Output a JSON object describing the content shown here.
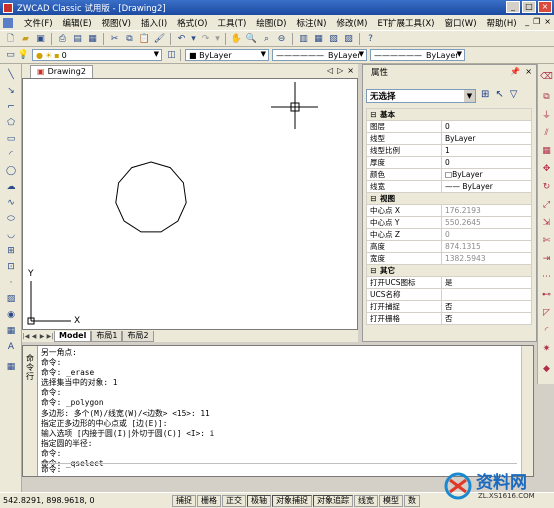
{
  "window": {
    "title": "ZWCAD Classic 试用版 - [Drawing2]"
  },
  "menu": [
    "文件(F)",
    "编辑(E)",
    "视图(V)",
    "插入(I)",
    "格式(O)",
    "工具(T)",
    "绘图(D)",
    "标注(N)",
    "修改(M)",
    "ET扩展工具(X)",
    "窗口(W)",
    "帮助(H)"
  ],
  "layerbar": {
    "layer_value": "0",
    "color_value": "■ ByLayer",
    "linetype_value": "ByLayer",
    "lineweight_value": "ByLayer"
  },
  "document": {
    "tab_label": "Drawing2"
  },
  "axes": {
    "x": "X",
    "y": "Y"
  },
  "layout_tabs": [
    "Model",
    "布局1",
    "布局2"
  ],
  "properties": {
    "title": "属性",
    "selection": "无选择",
    "categories": [
      {
        "name": "基本",
        "rows": [
          {
            "key": "图层",
            "value": "0"
          },
          {
            "key": "线型",
            "value": "ByLayer"
          },
          {
            "key": "线型比例",
            "value": "1"
          },
          {
            "key": "厚度",
            "value": "0"
          },
          {
            "key": "颜色",
            "value": "□ByLayer"
          },
          {
            "key": "线宽",
            "value": "—— ByLayer"
          }
        ]
      },
      {
        "name": "视图",
        "rows": [
          {
            "key": "中心点 X",
            "value": "176.2193",
            "muted": true
          },
          {
            "key": "中心点 Y",
            "value": "550.2645",
            "muted": true
          },
          {
            "key": "中心点 Z",
            "value": "0",
            "muted": true
          },
          {
            "key": "高度",
            "value": "874.1315",
            "muted": true
          },
          {
            "key": "宽度",
            "value": "1382.5943",
            "muted": true
          }
        ]
      },
      {
        "name": "其它",
        "rows": [
          {
            "key": "打开UCS图标",
            "value": "是"
          },
          {
            "key": "UCS名称",
            "value": ""
          },
          {
            "key": "打开捕捉",
            "value": "否"
          },
          {
            "key": "打开栅格",
            "value": "否"
          }
        ]
      }
    ]
  },
  "command": {
    "side_label": "命令行",
    "lines": [
      "另一角点:",
      "命令:",
      "命令: _erase",
      "选择集当中的对象: 1",
      "命令:",
      "命令: _polygon",
      "多边形: 多个(M)/线宽(W)/<边数> <15>: 11",
      "指定正多边形的中心点或 [边(E)]:",
      "输入选项 [内接于圆(I)|外切于圆(C)] <I>: i",
      "指定圆的半径:",
      "命令:",
      "命令: _qselect"
    ],
    "prompt": "命令:"
  },
  "status": {
    "coords": "542.8291, 898.9618, 0",
    "buttons": [
      "捕捉",
      "栅格",
      "正交",
      "极轴",
      "对象捕捉",
      "对象追踪",
      "线宽",
      "模型",
      "数"
    ]
  },
  "watermark": {
    "text": "资料网",
    "url": "ZL.XS1616.COM"
  }
}
